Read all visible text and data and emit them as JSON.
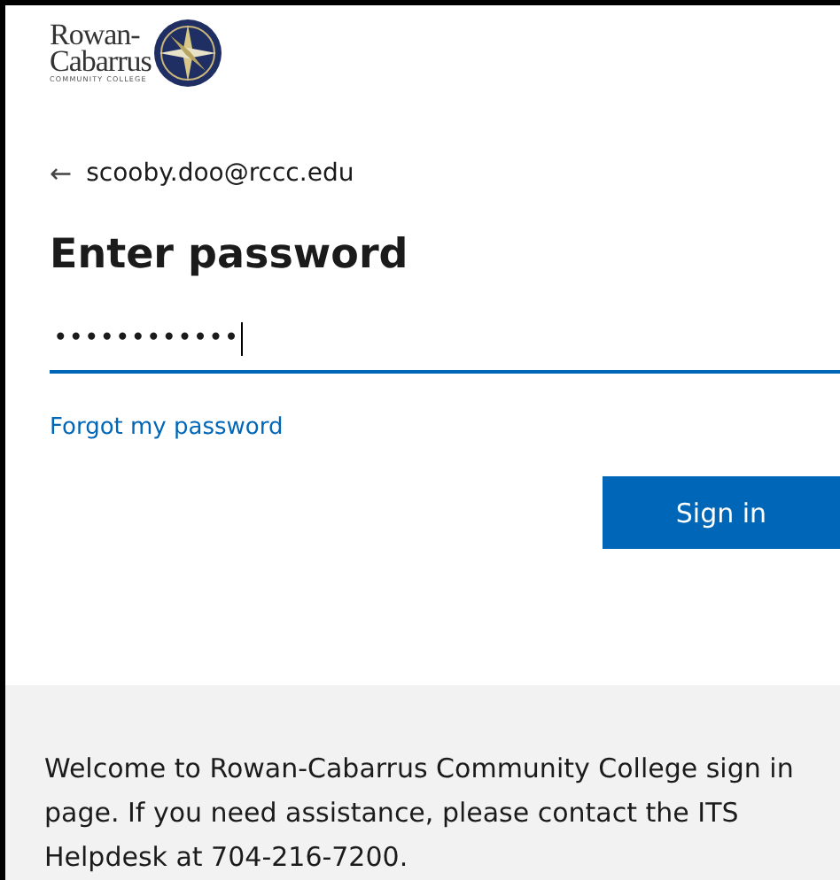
{
  "logo": {
    "lines": [
      "Rowan-",
      "Cabarrus"
    ],
    "tagline": "COMMUNITY COLLEGE"
  },
  "account": {
    "back_icon": "←",
    "email": "scooby.doo@rccc.edu"
  },
  "heading": "Enter password",
  "password_field": {
    "value": "••••••••••••",
    "focused": true
  },
  "forgot_link": "Forgot my password",
  "sign_in_button": "Sign in",
  "footer": {
    "text": "Welcome to Rowan-Cabarrus Community College sign in page. If you need assistance, please contact the ITS Helpdesk at 704-216-7200."
  }
}
